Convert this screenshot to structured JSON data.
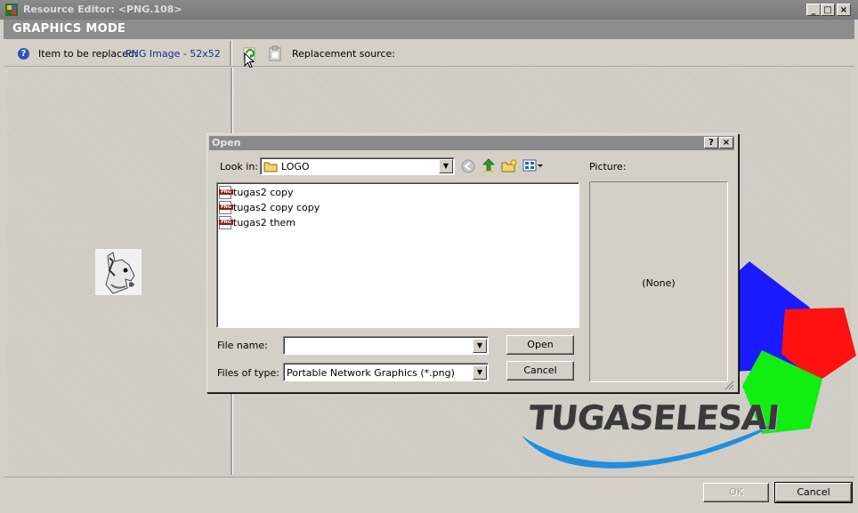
{
  "window": {
    "title": "Resource Editor: <PNG.108>",
    "controls": [
      "_",
      "□",
      "×"
    ]
  },
  "mode_title": "GRAPHICS MODE",
  "info": {
    "item_label": "Item to be replaced:",
    "item_value": "PNG Image - 52x52",
    "replacement_label": "Replacement source:"
  },
  "footer": {
    "ok_label": "OK",
    "cancel_label": "Cancel"
  },
  "dialog": {
    "title": "Open",
    "help_btn": "?",
    "close_btn": "×",
    "look_in_label": "Look in:",
    "look_in_value": "LOGO",
    "files": [
      {
        "name": "tugas2 copy",
        "type_badge": "PNG"
      },
      {
        "name": "tugas2 copy copy",
        "type_badge": "PNG"
      },
      {
        "name": "tugas2 them",
        "type_badge": "PNG"
      }
    ],
    "file_name_label": "File name:",
    "file_name_value": "",
    "files_of_type_label": "Files of type:",
    "files_of_type_value": "Portable Network Graphics (*.png)",
    "open_label": "Open",
    "cancel_label": "Cancel",
    "picture_label": "Picture:",
    "preview_text": "(None)"
  },
  "watermark": {
    "text": "TUGASELESAI",
    "colors": {
      "blue": "#1a1aff",
      "red": "#ff1111",
      "green": "#11ee11",
      "swoosh": "#1e8fe0",
      "text": "#3a3a3a"
    }
  },
  "icons": {
    "app": "app-icon",
    "help": "help-icon",
    "refresh": "refresh-icon",
    "clipboard": "clipboard-icon",
    "back": "back-icon",
    "up": "up-folder-icon",
    "new_folder": "new-folder-icon",
    "view_menu": "view-menu-icon"
  }
}
